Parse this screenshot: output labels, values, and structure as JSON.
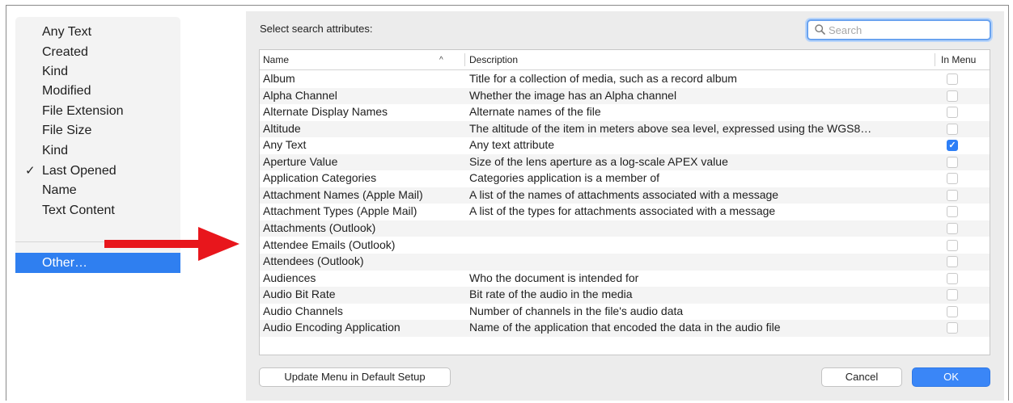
{
  "menu": {
    "items": [
      {
        "label": "Any Text",
        "checked": false
      },
      {
        "label": "Created",
        "checked": false
      },
      {
        "label": "Kind",
        "checked": false
      },
      {
        "label": "Modified",
        "checked": false
      },
      {
        "label": "File Extension",
        "checked": false
      },
      {
        "label": "File Size",
        "checked": false
      },
      {
        "label": "Kind",
        "checked": false
      },
      {
        "label": "Last Opened",
        "checked": true
      },
      {
        "label": "Name",
        "checked": false
      },
      {
        "label": "Text Content",
        "checked": false
      }
    ],
    "check_glyph": "✓",
    "other_label": "Other…"
  },
  "dialog": {
    "label": "Select search attributes:",
    "search_placeholder": "Search",
    "columns": {
      "name": "Name",
      "description": "Description",
      "in_menu": "In Menu"
    },
    "sort_indicator": "^",
    "rows": [
      {
        "name": "Album",
        "description": "Title for a collection of media, such as a record album",
        "in_menu": false
      },
      {
        "name": "Alpha Channel",
        "description": "Whether the image has an Alpha channel",
        "in_menu": false
      },
      {
        "name": "Alternate Display Names",
        "description": "Alternate names of the file",
        "in_menu": false
      },
      {
        "name": "Altitude",
        "description": "The altitude of the item in meters above sea level, expressed using the WGS8…",
        "in_menu": false
      },
      {
        "name": "Any Text",
        "description": "Any text attribute",
        "in_menu": true
      },
      {
        "name": "Aperture Value",
        "description": "Size of the lens aperture as a log-scale APEX value",
        "in_menu": false
      },
      {
        "name": "Application Categories",
        "description": "Categories application is a member of",
        "in_menu": false
      },
      {
        "name": "Attachment Names (Apple Mail)",
        "description": "A list of the names of attachments associated with a message",
        "in_menu": false
      },
      {
        "name": "Attachment Types (Apple Mail)",
        "description": "A list of the types for attachments associated with a message",
        "in_menu": false
      },
      {
        "name": "Attachments (Outlook)",
        "description": "",
        "in_menu": false
      },
      {
        "name": "Attendee Emails (Outlook)",
        "description": "",
        "in_menu": false
      },
      {
        "name": "Attendees (Outlook)",
        "description": "",
        "in_menu": false
      },
      {
        "name": "Audiences",
        "description": "Who the document is intended for",
        "in_menu": false
      },
      {
        "name": "Audio Bit Rate",
        "description": "Bit rate of the audio in the media",
        "in_menu": false
      },
      {
        "name": "Audio Channels",
        "description": "Number of channels in the file's audio data",
        "in_menu": false
      },
      {
        "name": "Audio Encoding Application",
        "description": "Name of the application that encoded the data in the audio file",
        "in_menu": false
      }
    ],
    "buttons": {
      "update": "Update Menu in Default Setup",
      "cancel": "Cancel",
      "ok": "OK"
    }
  },
  "colors": {
    "accent": "#2f7ff0",
    "arrow": "#e8161c",
    "ok_button": "#3a86f7"
  },
  "icons": {
    "search": "search-icon",
    "checkbox_checked": "checkmark-icon",
    "arrow": "red-arrow-icon"
  }
}
